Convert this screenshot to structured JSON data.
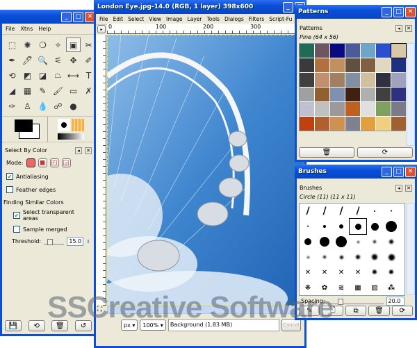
{
  "toolbox": {
    "menu": [
      "File",
      "Xtns",
      "Help"
    ],
    "tools": [
      "⬚",
      "✺",
      "❍",
      "✧",
      "▣",
      "✂",
      "✒",
      "🖊",
      "🔍",
      "⚟",
      "✥",
      "✐",
      "⟲",
      "◩",
      "◪",
      "⏢",
      "⟷",
      "T",
      "◢",
      "▦",
      "✎",
      "🖌",
      "▭",
      "✗",
      "✑",
      "♙",
      "💧",
      "☍",
      "●"
    ],
    "panel_title": "Select By Color",
    "mode_label": "Mode:",
    "antialiasing": "Antialiasing",
    "feather": "Feather edges",
    "finding": "Finding Similar Colors",
    "select_transparent": "Select transparent areas",
    "sample_merged": "Sample merged",
    "threshold_label": "Threshold:",
    "threshold_value": "15.0",
    "threshold_fraction": 0.15
  },
  "image_window": {
    "title": "London Eye.jpg-14.0 (RGB, 1 layer) 398x600",
    "menu": [
      "File",
      "Edit",
      "Select",
      "View",
      "Image",
      "Layer",
      "Tools",
      "Dialogs",
      "Filters",
      "Script-Fu"
    ],
    "ruler": [
      "0",
      "100",
      "200",
      "300"
    ],
    "unit": "px",
    "zoom": "100%",
    "status": "Background (1.83 MB)",
    "cancel": "Cancel"
  },
  "patterns": {
    "window_title": "Patterns",
    "panel_title": "Patterns",
    "selected": "Pine (64 x 56)",
    "colors": [
      "#1f6b55",
      "#6e5560",
      "#0a0a80",
      "#4a5a9a",
      "#6fa6c8",
      "#2a4fd0",
      "#d8c8a8",
      "#3a3a3a",
      "#b07040",
      "#c09060",
      "#605040",
      "#806040",
      "#e0d8c0",
      "#203080",
      "#404040",
      "#c09070",
      "#a08060",
      "#8090a0",
      "#d0c0a0",
      "#303040",
      "#a0a0c0",
      "#a0a0a0",
      "#906030",
      "#8090b0",
      "#402010",
      "#b0b0b0",
      "#404040",
      "#303080",
      "#c0c0d0",
      "#c0c0c0",
      "#9a9a9a",
      "#c06020",
      "#e0e0e0",
      "#80a060",
      "#7a7a8a",
      "#c04010",
      "#b06030",
      "#d09050",
      "#808090",
      "#e0a040",
      "#f0d080",
      "#a06030"
    ]
  },
  "brushes": {
    "window_title": "Brushes",
    "panel_title": "Brushes",
    "selected": "Circle (11) (11 x 11)",
    "spacing_label": "Spacing:",
    "spacing_value": "20.0",
    "spacing_fraction": 0.2
  },
  "watermark": "SSCreative Software"
}
